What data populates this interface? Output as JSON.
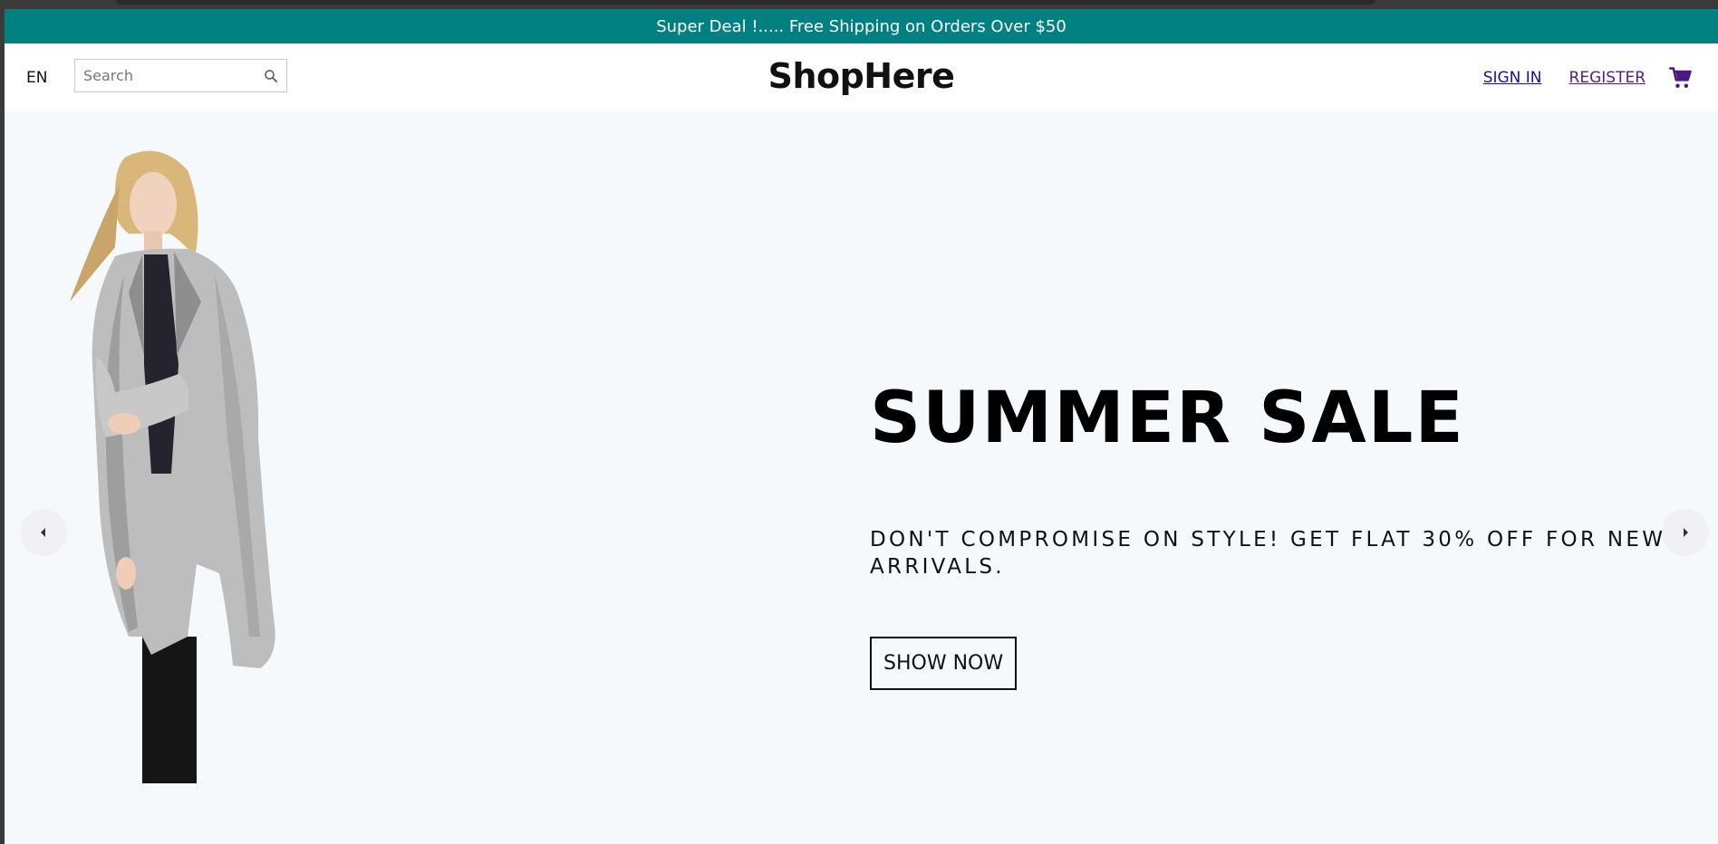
{
  "announcement": {
    "text": "Super Deal !..... Free Shipping on Orders Over $50",
    "bg_color": "#008080"
  },
  "navbar": {
    "language": "EN",
    "search": {
      "placeholder": "Search",
      "value": "",
      "icon": "search-icon"
    },
    "logo": "ShopHere",
    "links": {
      "sign_in": "SIGN IN",
      "register": "REGISTER"
    },
    "cart_icon": "shopping-cart-icon"
  },
  "hero": {
    "title": "SUMMER SALE",
    "description": "DON'T COMPROMISE ON STYLE! GET FLAT 30% OFF FOR NEW ARRIVALS.",
    "button_label": "SHOW NOW",
    "bg_color": "#f5f9fb",
    "left_arrow_icon": "arrow-left-icon",
    "right_arrow_icon": "arrow-right-icon"
  }
}
